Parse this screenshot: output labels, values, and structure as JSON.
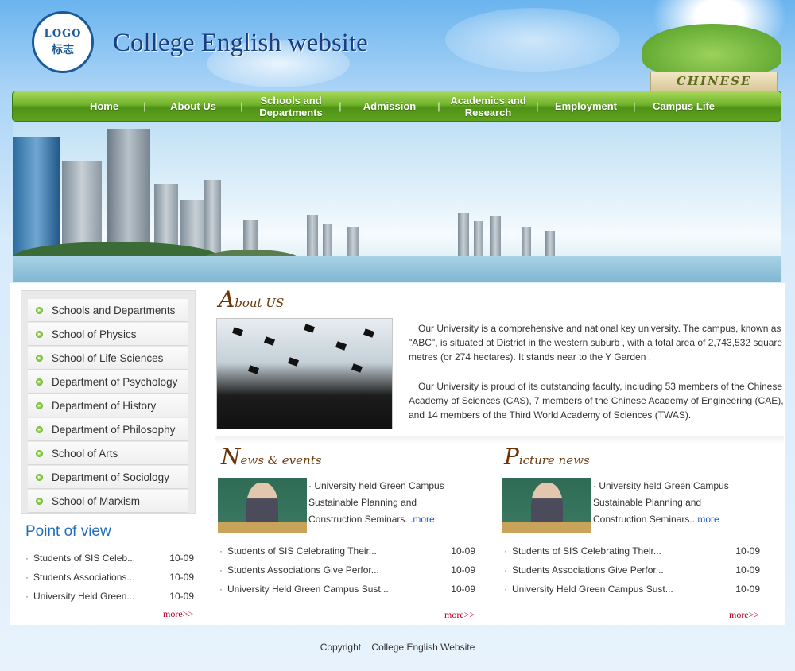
{
  "header": {
    "logo_line1": "LOGO",
    "logo_line2": "标志",
    "title": "College English website",
    "lang_button": "CHINESE"
  },
  "nav": {
    "items": [
      {
        "label": "Home"
      },
      {
        "label": "About Us"
      },
      {
        "label": "Schools and Departments"
      },
      {
        "label": "Admission"
      },
      {
        "label": "Academics and Research"
      },
      {
        "label": "Employment"
      },
      {
        "label": "Campus Life"
      }
    ],
    "separator": "|"
  },
  "sidebar": {
    "items": [
      {
        "label": "Schools and Departments"
      },
      {
        "label": "School of Physics"
      },
      {
        "label": "School of Life Sciences"
      },
      {
        "label": "Department of Psychology"
      },
      {
        "label": "Department of History"
      },
      {
        "label": "Department of Philosophy"
      },
      {
        "label": "School of Arts"
      },
      {
        "label": "Department of Sociology"
      },
      {
        "label": "School of Marxism"
      }
    ]
  },
  "point_of_view": {
    "title": "Point of view",
    "rows": [
      {
        "title": "Students of SIS Celeb...",
        "date": "10-09"
      },
      {
        "title": "Students Associations...",
        "date": "10-09"
      },
      {
        "title": "University Held Green...",
        "date": "10-09"
      }
    ],
    "more": "more>>"
  },
  "about": {
    "title_initial": "A",
    "title_rest": "bout US",
    "para1": "Our University is a comprehensive and national key university. The campus, known as \"ABC\", is situated at District in the western suburb , with a total area of 2,743,532 square metres (or 274 hectares). It stands near to the Y Garden .",
    "para2": "Our University is proud of its outstanding faculty, including 53 members of the Chinese Academy of Sciences (CAS), 7 members of the Chinese Academy of Engineering (CAE), and 14 members of the Third World Academy of Sciences (TWAS)."
  },
  "news": {
    "title_initial": "N",
    "title_rest": "ews & events",
    "feature_text": "· University held Green Campus Sustainable Planning and Construction Seminars...",
    "feature_more": "more",
    "rows": [
      {
        "title": "Students of SIS Celebrating Their...",
        "date": "10-09"
      },
      {
        "title": "Students Associations Give Perfor...",
        "date": "10-09"
      },
      {
        "title": "University Held Green Campus Sust...",
        "date": "10-09"
      }
    ],
    "more": "more>>"
  },
  "picture_news": {
    "title_initial": "P",
    "title_rest": "icture news",
    "feature_text": "· University held Green Campus Sustainable Planning and Construction Seminars...",
    "feature_more": "more",
    "rows": [
      {
        "title": "Students of SIS Celebrating Their...",
        "date": "10-09"
      },
      {
        "title": "Students Associations Give Perfor...",
        "date": "10-09"
      },
      {
        "title": "University Held Green Campus Sust...",
        "date": "10-09"
      }
    ],
    "more": "more>>"
  },
  "footer": {
    "text": "Copyright    College English Website"
  },
  "bullet_dot": "·"
}
